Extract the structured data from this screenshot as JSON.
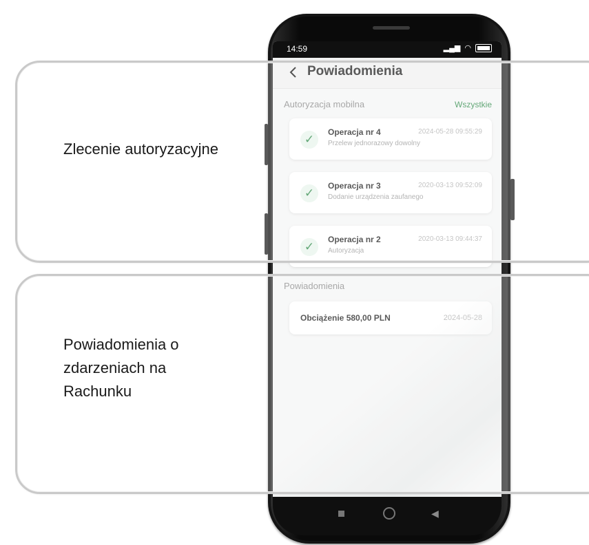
{
  "callouts": {
    "authorization": "Zlecenie autoryzacyjne",
    "account_notifications": "Powiadomienia o zdarzeniach na Rachunku"
  },
  "statusbar": {
    "time": "14:59"
  },
  "appbar": {
    "title": "Powiadomienia"
  },
  "mobile_auth": {
    "header": "Autoryzacja mobilna",
    "link": "Wszystkie",
    "operations": [
      {
        "title": "Operacja nr 4",
        "date": "2024-05-28 09:55:29",
        "subtitle": "Przelew jednorazowy dowolny"
      },
      {
        "title": "Operacja nr 3",
        "date": "2020-03-13 09:52:09",
        "subtitle": "Dodanie urządzenia zaufanego"
      },
      {
        "title": "Operacja nr 2",
        "date": "2020-03-13 09:44:37",
        "subtitle": "Autoryzacja"
      }
    ]
  },
  "notifications": {
    "header": "Powiadomienia",
    "items": [
      {
        "title": "Obciążenie 580,00 PLN",
        "date": "2024-05-28"
      }
    ]
  },
  "colors": {
    "accent": "#2f8a4a"
  },
  "icons": {
    "back": "chevron-left-icon",
    "check": "check-icon"
  }
}
